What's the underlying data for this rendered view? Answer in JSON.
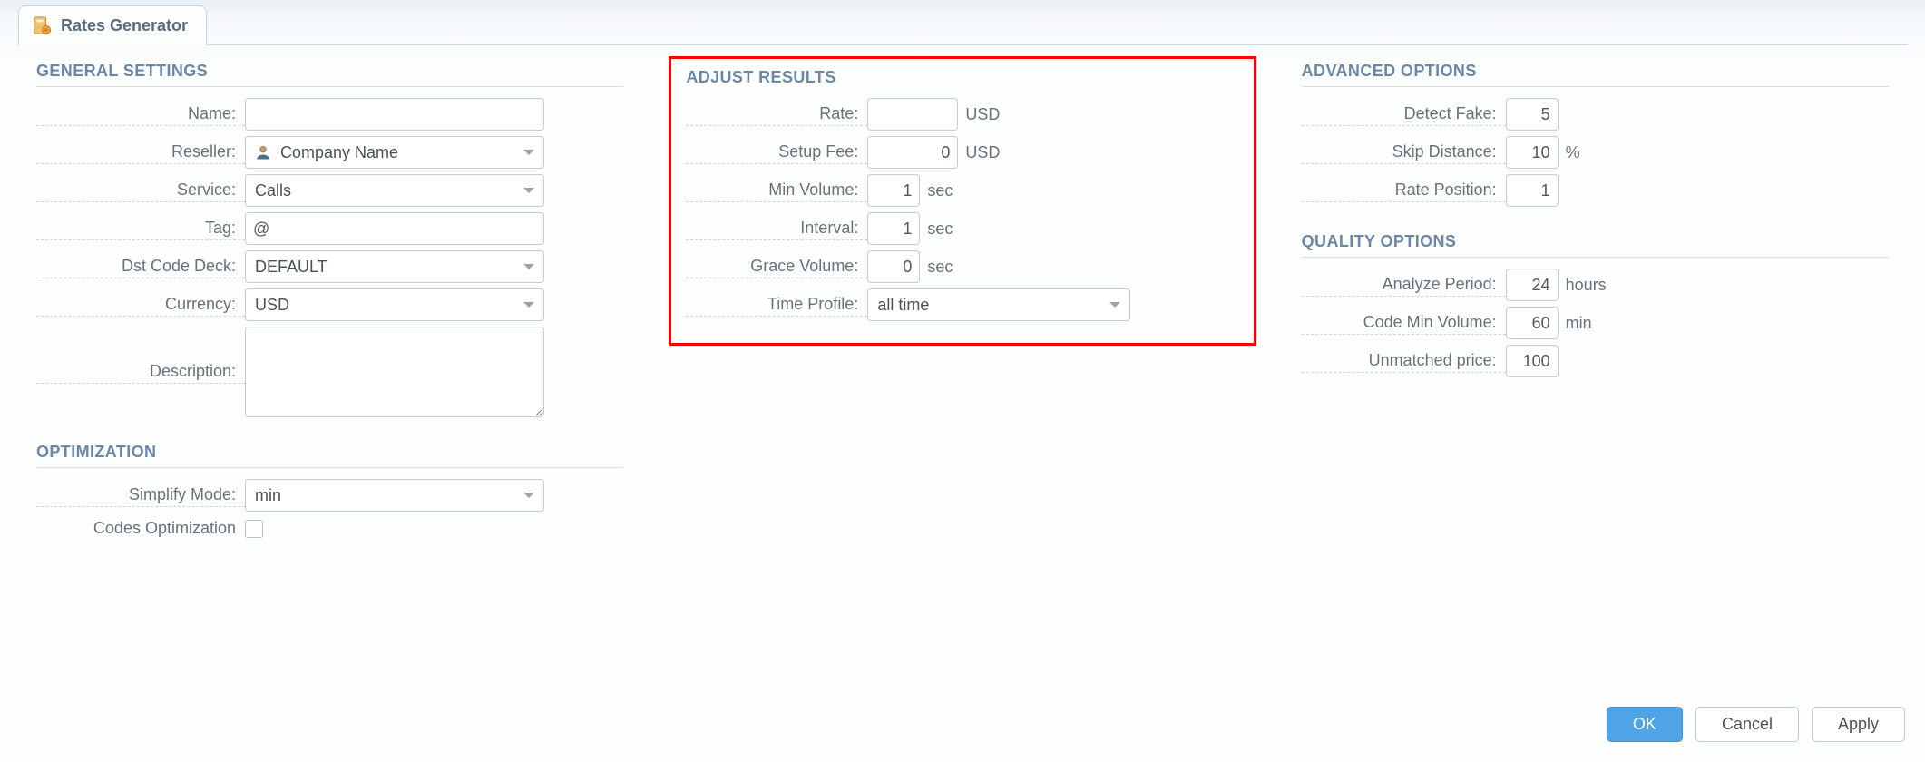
{
  "tab": {
    "title": "Rates Generator"
  },
  "sections": {
    "general": "GENERAL SETTINGS",
    "optimization": "OPTIMIZATION",
    "adjust": "ADJUST RESULTS",
    "advanced": "ADVANCED OPTIONS",
    "quality": "QUALITY OPTIONS"
  },
  "general": {
    "name_label": "Name:",
    "name_value": "",
    "reseller_label": "Reseller:",
    "reseller_value": "Company Name",
    "service_label": "Service:",
    "service_value": "Calls",
    "tag_label": "Tag:",
    "tag_value": "@",
    "deck_label": "Dst Code Deck:",
    "deck_value": "DEFAULT",
    "currency_label": "Currency:",
    "currency_value": "USD",
    "description_label": "Description:",
    "description_value": ""
  },
  "optimization": {
    "simplify_label": "Simplify Mode:",
    "simplify_value": "min",
    "codes_label": "Codes Optimization",
    "codes_checked": false
  },
  "adjust": {
    "rate_label": "Rate:",
    "rate_value": "",
    "rate_unit": "USD",
    "setup_label": "Setup Fee:",
    "setup_value": "0",
    "setup_unit": "USD",
    "minvol_label": "Min Volume:",
    "minvol_value": "1",
    "minvol_unit": "sec",
    "interval_label": "Interval:",
    "interval_value": "1",
    "interval_unit": "sec",
    "grace_label": "Grace Volume:",
    "grace_value": "0",
    "grace_unit": "sec",
    "timeprofile_label": "Time Profile:",
    "timeprofile_value": "all time"
  },
  "advanced": {
    "detect_label": "Detect Fake:",
    "detect_value": "5",
    "skip_label": "Skip Distance:",
    "skip_value": "10",
    "skip_unit": "%",
    "ratepos_label": "Rate Position:",
    "ratepos_value": "1"
  },
  "quality": {
    "analyze_label": "Analyze Period:",
    "analyze_value": "24",
    "analyze_unit": "hours",
    "codemin_label": "Code Min Volume:",
    "codemin_value": "60",
    "codemin_unit": "min",
    "unmatched_label": "Unmatched price:",
    "unmatched_value": "100"
  },
  "buttons": {
    "ok": "OK",
    "cancel": "Cancel",
    "apply": "Apply"
  }
}
